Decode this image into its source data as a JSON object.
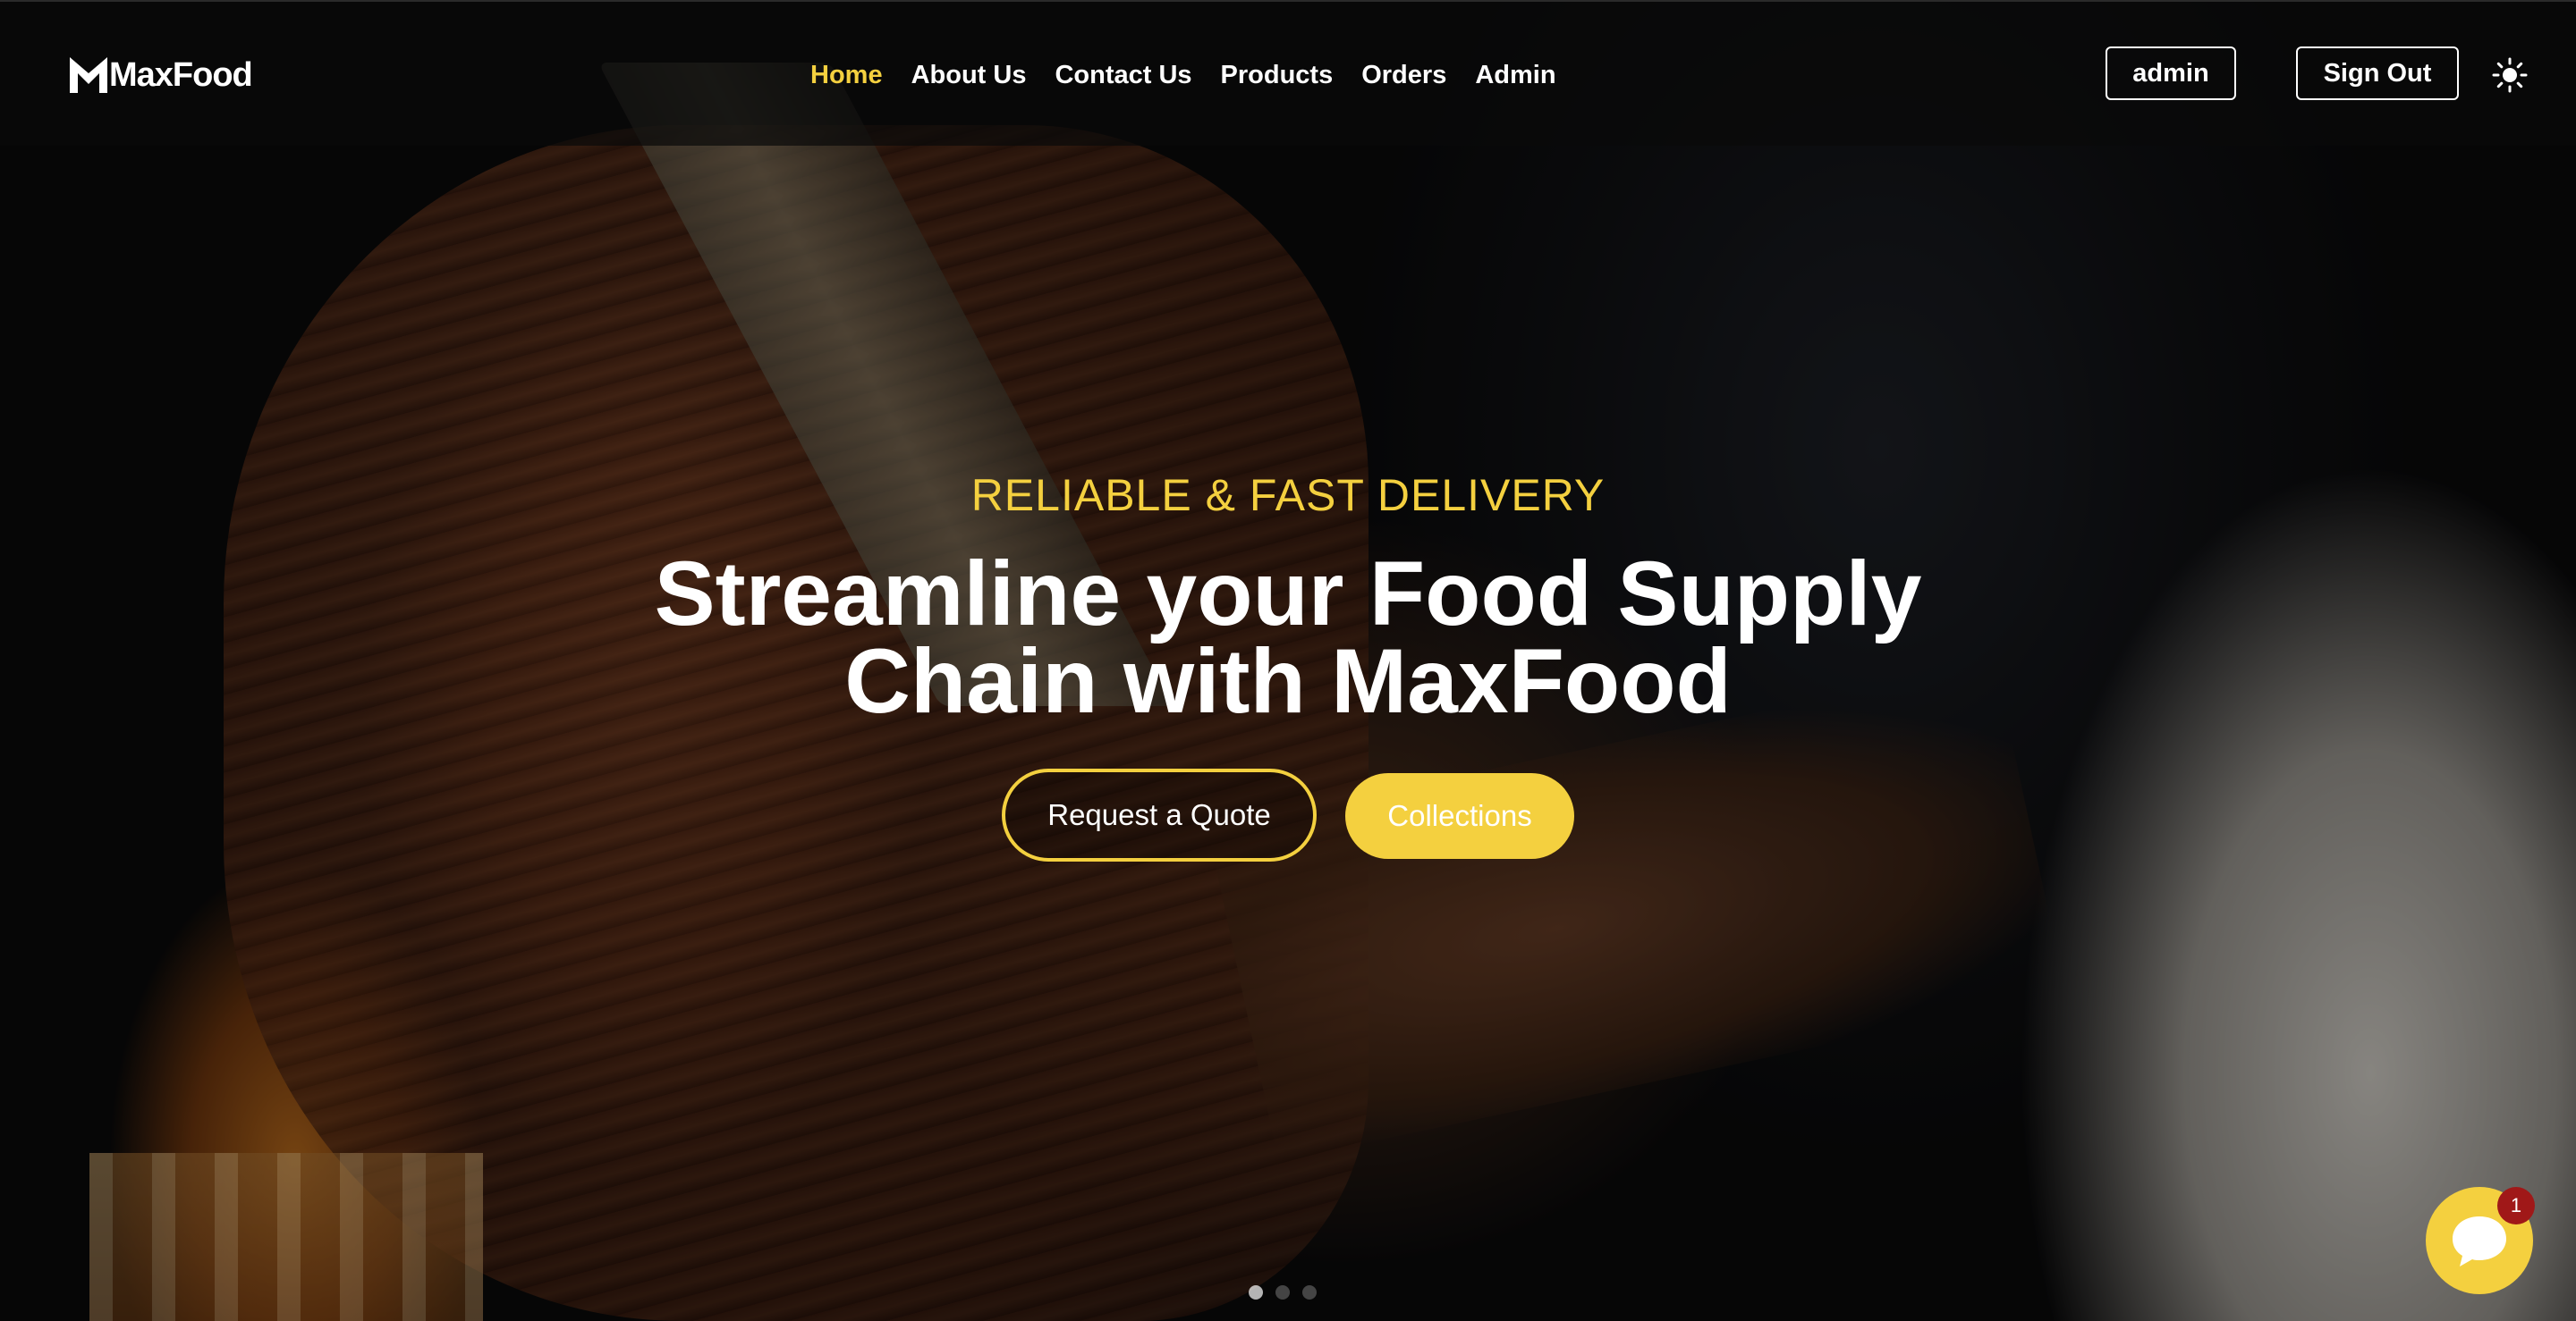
{
  "brand": {
    "name": "MaxFood",
    "accent_color": "#f4d03f"
  },
  "nav": {
    "items": [
      {
        "label": "Home",
        "active": true
      },
      {
        "label": "About Us",
        "active": false
      },
      {
        "label": "Contact Us",
        "active": false
      },
      {
        "label": "Products",
        "active": false
      },
      {
        "label": "Orders",
        "active": false
      },
      {
        "label": "Admin",
        "active": false
      }
    ],
    "user_label": "admin",
    "signout_label": "Sign Out",
    "theme_icon": "sun-icon"
  },
  "hero": {
    "eyebrow": "RELIABLE & FAST DELIVERY",
    "headline_line1": "Streamline your Food Supply",
    "headline_line2": "Chain with MaxFood",
    "primary_cta": "Request a Quote",
    "secondary_cta": "Collections",
    "slides": {
      "count": 3,
      "active_index": 0
    }
  },
  "chat": {
    "icon": "chat-bubble-icon",
    "unread_count": "1",
    "badge_color": "#a01818"
  }
}
